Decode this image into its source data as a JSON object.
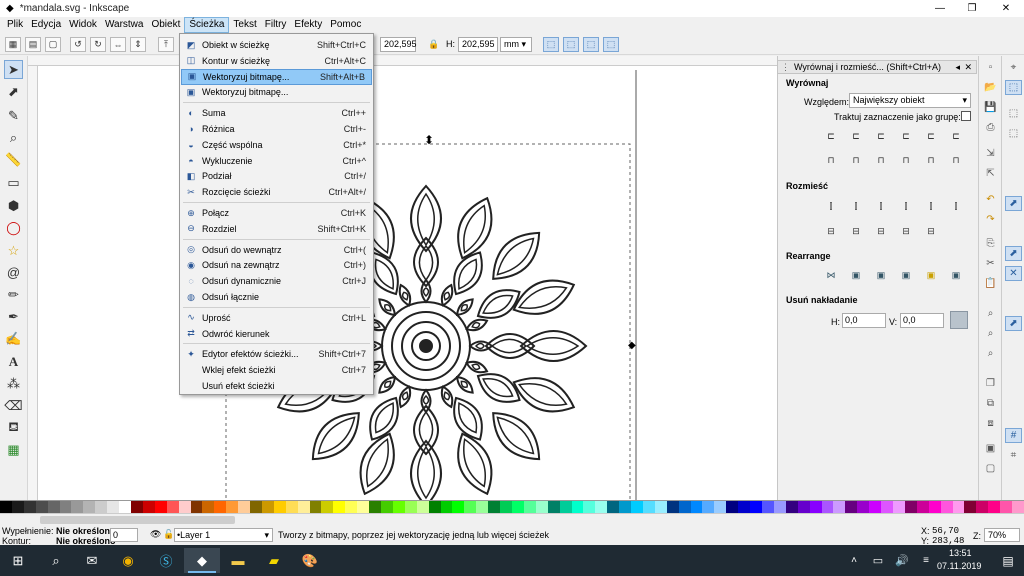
{
  "window": {
    "title": "*mandala.svg - Inkscape",
    "icon": "inkscape-icon"
  },
  "menubar": [
    "Plik",
    "Edycja",
    "Widok",
    "Warstwa",
    "Obiekt",
    "Ścieżka",
    "Tekst",
    "Filtry",
    "Efekty",
    "Pomoc"
  ],
  "toolctrl": {
    "w_value": "202,595",
    "h_label": "H:",
    "h_value": "202,595",
    "unit": "mm"
  },
  "path_menu": {
    "items": [
      {
        "label": "Obiekt w ścieżkę",
        "shortcut": "Shift+Ctrl+C",
        "icon": "object-to-path-icon"
      },
      {
        "label": "Kontur w ścieżkę",
        "shortcut": "Ctrl+Alt+C",
        "icon": "stroke-to-path-icon"
      },
      {
        "label": "Wektoryzuj bitmapę...",
        "shortcut": "Shift+Alt+B",
        "icon": "trace-bitmap-icon"
      },
      {
        "label": "Wektoryzuj bitmapę...",
        "shortcut": "",
        "icon": "trace-pixel-art-icon"
      },
      {
        "label": "Suma",
        "shortcut": "Ctrl++",
        "icon": "union-icon"
      },
      {
        "label": "Różnica",
        "shortcut": "Ctrl+-",
        "icon": "difference-icon"
      },
      {
        "label": "Część wspólna",
        "shortcut": "Ctrl+*",
        "icon": "intersection-icon"
      },
      {
        "label": "Wykluczenie",
        "shortcut": "Ctrl+^",
        "icon": "exclusion-icon"
      },
      {
        "label": "Podział",
        "shortcut": "Ctrl+/",
        "icon": "division-icon"
      },
      {
        "label": "Rozcięcie ścieżki",
        "shortcut": "Ctrl+Alt+/",
        "icon": "cut-path-icon"
      },
      {
        "label": "Połącz",
        "shortcut": "Ctrl+K",
        "icon": "combine-icon"
      },
      {
        "label": "Rozdziel",
        "shortcut": "Shift+Ctrl+K",
        "icon": "break-apart-icon"
      },
      {
        "label": "Odsuń do wewnątrz",
        "shortcut": "Ctrl+(",
        "icon": "inset-icon"
      },
      {
        "label": "Odsuń na zewnątrz",
        "shortcut": "Ctrl+)",
        "icon": "outset-icon"
      },
      {
        "label": "Odsuń dynamicznie",
        "shortcut": "Ctrl+J",
        "icon": "dynamic-offset-icon"
      },
      {
        "label": "Odsuń łącznie",
        "shortcut": "",
        "icon": "linked-offset-icon"
      },
      {
        "label": "Uprość",
        "shortcut": "Ctrl+L",
        "icon": "simplify-icon"
      },
      {
        "label": "Odwróć kierunek",
        "shortcut": "",
        "icon": "reverse-icon"
      },
      {
        "label": "Edytor efektów ścieżki...",
        "shortcut": "Shift+Ctrl+7",
        "icon": "path-effects-icon"
      },
      {
        "label": "Wklej efekt ścieżki",
        "shortcut": "Ctrl+7",
        "icon": ""
      },
      {
        "label": "Usuń efekt ścieżki",
        "shortcut": "",
        "icon": ""
      }
    ],
    "highlighted_index": 2
  },
  "align_panel": {
    "title": "Wyrównaj i rozmieść... (Shift+Ctrl+A)",
    "align_header": "Wyrównaj",
    "relative_label": "Względem:",
    "relative_value": "Największy obiekt",
    "treat_group_label": "Traktuj zaznaczenie jako grupę:",
    "distribute_header": "Rozmieść",
    "rearrange_header": "Rearrange",
    "overlap_header": "Usuń nakładanie",
    "h_label": "H:",
    "h_value": "0,0",
    "v_label": "V:",
    "v_value": "0,0"
  },
  "statusbar": {
    "fill_label": "Wypełnienie:",
    "fill_value": "Nie określono",
    "stroke_label": "Kontur:",
    "stroke_value": "Nie określono",
    "opacity": "0",
    "layer": "•Layer 1",
    "message": "Tworzy z bitmapy, poprzez jej wektoryzację jedną lub więcej ścieżek",
    "x_label": "X:",
    "x_value": "56,70",
    "y_label": "Y:",
    "y_value": "283,48",
    "zoom_label": "Z:",
    "zoom_value": "70%"
  },
  "taskbar": {
    "time": "13:51",
    "date": "07.11.2019"
  }
}
